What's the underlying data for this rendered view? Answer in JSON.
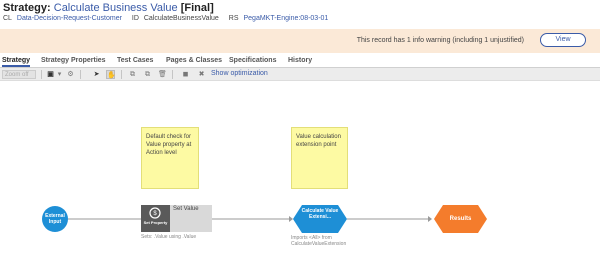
{
  "header": {
    "prefix": "Strategy:",
    "name": "Calculate Business Value",
    "status": "[Final]",
    "cl_label": "CL",
    "cl_value": "Data-Decision-Request-Customer",
    "id_label": "ID",
    "id_value": "CalculateBusinessValue",
    "rs_label": "RS",
    "rs_value": "PegaMKT-Engine:08-03-01"
  },
  "warning": {
    "text": "This record has 1 info warning (including 1 unjustified)",
    "button": "View"
  },
  "tabs": [
    {
      "label": "Strategy"
    },
    {
      "label": "Strategy Properties"
    },
    {
      "label": "Test Cases"
    },
    {
      "label": "Pages & Classes"
    },
    {
      "label": "Specifications"
    },
    {
      "label": "History"
    }
  ],
  "toolbar": {
    "zoom_placeholder": "Zoom off",
    "show_optimization": "Show optimization"
  },
  "notes": [
    {
      "text": "Default check for Value property at Action level"
    },
    {
      "text": "Value calculation extension point"
    }
  ],
  "nodes": {
    "external_input": "External Input",
    "set_value_icon_label": "Set Property",
    "set_value_title": "Set Value",
    "set_value_sub": "Sets: .Value using .Value",
    "calc_value": "Calculate Value Extensi...",
    "calc_sub_line1": "Imports <All> from",
    "calc_sub_line2": "CalculateValueExtension",
    "results": "Results"
  },
  "colors": {
    "accent": "#3a5ba8",
    "warning_bg": "#fbe9d7",
    "note_bg": "#fdfaa3",
    "input_node": "#1e8fd6",
    "calc_node": "#1e8fd6",
    "results_node": "#f47c2c",
    "set_value_box": "#d9d9d9"
  }
}
